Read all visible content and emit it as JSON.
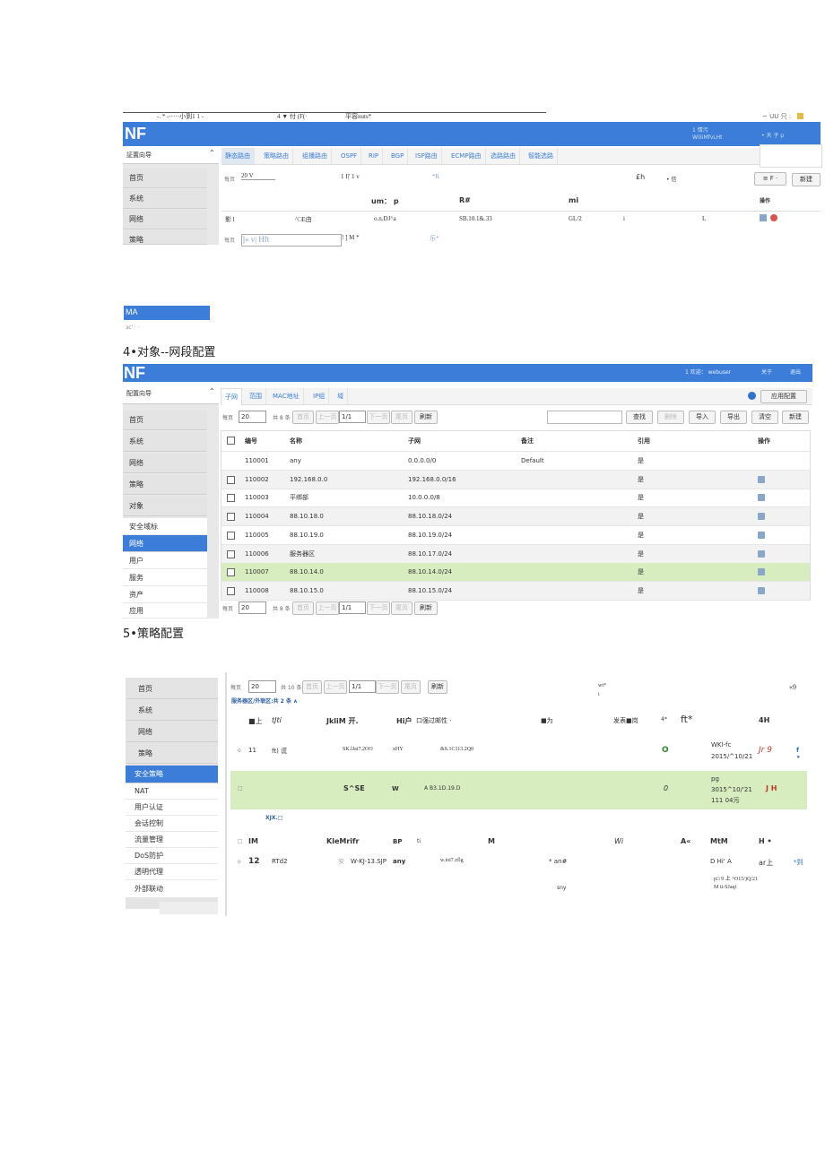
{
  "s1": {
    "top_text": "-. * -·····小到1 1 -",
    "top_text2": "4 ▼ 付 (F(·",
    "top_text3": "平容nuts*",
    "top_right": "~ UU 只 :",
    "logo": "NF",
    "header_right1": "1 情汚",
    "header_right2": "WiliiMfvLHt",
    "header_right3": "• 天 子 p",
    "sidebar_title": "証置向导",
    "sidebar_items": [
      "首页",
      "系统",
      "网络",
      "策略"
    ],
    "tabs": [
      "静态路由",
      "策略路由",
      "组播路由",
      "OSPF",
      "RIP",
      "BGP",
      "ISP路由",
      "ECMP路由",
      "选路路由",
      "智能选路"
    ],
    "toolbar_left": "每页",
    "toolbar_sel": "20 V",
    "toolbar_mid": "1 I|' 1 v",
    "toolbar_k": "*K",
    "toolbar_eh": "£h",
    "toolbar_fi": "• 信",
    "toolbar_right": "≡ F ·",
    "toolbar_btn": "新建",
    "header_cols": [
      "um： p",
      "R#",
      "mi",
      "操作"
    ],
    "row": [
      "影 l",
      "^□E由",
      "o.n.DJ^a",
      "SB.10.1&.33",
      "GL/2",
      "i",
      "L"
    ],
    "footer_left": "每页",
    "footer_sel": "]» v| Hft",
    "footer_mid": "! ] M *",
    "footer_k": "乐*"
  },
  "ma": {
    "label": "MA",
    "sub": "зс' · ·"
  },
  "s2": {
    "heading": "4•对象--网段配置",
    "logo": "NF",
    "header_right1": "1 欢迎： webuser",
    "header_right2": "关于",
    "header_right3": "退出",
    "sidebar_title": "配置向导",
    "sidebar_items": [
      "首页",
      "系统",
      "网络",
      "策略",
      "对象"
    ],
    "sidebar_sub": [
      "安全域标",
      "网络",
      "用户",
      "服务",
      "资产",
      "应用"
    ],
    "tabs": [
      "子网",
      "范围",
      "MAC地址",
      "IP组",
      "域"
    ],
    "apply_btn": "应用配置",
    "per_page": "每页",
    "per_sel": "20",
    "total": "共 8 条",
    "first": "首页",
    "prev": "上一页",
    "page_sel": "1/1",
    "next": "下一页",
    "last": "尾页",
    "refresh": "刷新",
    "search_btn": "查找",
    "del_btn": "删除",
    "import_btn": "导入",
    "export_btn": "导出",
    "clear_btn": "清空",
    "new_btn": "新建",
    "cols": [
      "编号",
      "名称",
      "子网",
      "备注",
      "引用",
      "操作"
    ],
    "rows": [
      {
        "id": "110001",
        "name": "any",
        "subnet": "0.0.0.0/0",
        "note": "Default",
        "ref": "是"
      },
      {
        "id": "110002",
        "name": "192.168.0.0",
        "subnet": "192.168.0.0/16",
        "note": "",
        "ref": "是"
      },
      {
        "id": "110003",
        "name": "平绑部",
        "subnet": "10.0.0.0/8",
        "note": "",
        "ref": "是"
      },
      {
        "id": "110004",
        "name": "88.10.18.0",
        "subnet": "88.10.18.0/24",
        "note": "",
        "ref": "是"
      },
      {
        "id": "110005",
        "name": "88.10.19.0",
        "subnet": "88.10.19.0/24",
        "note": "",
        "ref": "是"
      },
      {
        "id": "110006",
        "name": "服务器区",
        "subnet": "88.10.17.0/24",
        "note": "",
        "ref": "是"
      },
      {
        "id": "110007",
        "name": "88.10.14.0",
        "subnet": "88.10.14.0/24",
        "note": "",
        "ref": "是"
      },
      {
        "id": "110008",
        "name": "88.10.15.0",
        "subnet": "88.10.15.0/24",
        "note": "",
        "ref": "是"
      }
    ]
  },
  "s3": {
    "heading": "5•策略配置",
    "sidebar_items": [
      "首页",
      "系统",
      "网络",
      "策略"
    ],
    "sidebar_sub": [
      "安全策略",
      "NAT",
      "用户认证",
      "会话控制",
      "流量管理",
      "DoS防护",
      "透明代理",
      "外部联动"
    ],
    "per_page": "每页",
    "per_sel": "20",
    "total": "共 10 条",
    "first": "首页",
    "prev": "上一页",
    "page_sel": "1/1",
    "next": "下一页",
    "last": "尾页",
    "refresh": "刷新",
    "zone_label": "服务器区/外联区:共 2 条 ∧",
    "top_wt": "wt*",
    "top_i": "i",
    "top_r": "«9",
    "h1": [
      "■上",
      "tJti",
      "JkliM 开.",
      "Hi户",
      "口强过邮性 ·",
      "■为",
      "发表■岗",
      "4*",
      "ft*",
      "4H"
    ],
    "r1": [
      "o",
      "11",
      "ft) 谎",
      "SK.lJai7.2OO",
      "xHY",
      "&S.1C113.2Q0",
      "O",
      "WKl-fc",
      "2015/^10/21",
      "Jr 9",
      "f •"
    ],
    "r2": [
      "□",
      "S^SE",
      "W",
      "A B3.1D.19.D",
      "0",
      "pg",
      "3015^10/'21",
      "111 04污",
      "J H"
    ],
    "xjx": "XJX.□",
    "h2": [
      "□",
      "IM",
      "KleMrifr",
      "BP",
      "ti",
      "M",
      "Wi",
      "A«",
      "MtM",
      "H •"
    ],
    "r3": [
      "o",
      "12",
      "RTd2",
      "安",
      "W-KJ-13.SJP",
      "any",
      "w.ioi7.zflg",
      "* an#",
      "D Hi' A",
      "ar上",
      "*到"
    ],
    "r3b": [
      "sny",
      "p□ 9 上 ^O15/)Q/21",
      "M ti-SJaqi"
    ]
  }
}
